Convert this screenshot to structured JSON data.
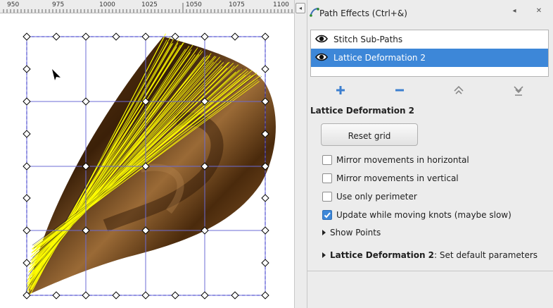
{
  "ruler": {
    "labels": [
      "950",
      "975",
      "1000",
      "1025",
      "1050",
      "1075",
      "1100"
    ]
  },
  "dialog": {
    "title": "Path Effects (Ctrl+&)",
    "iconify_glyph": "◂",
    "close_glyph": "✕",
    "collapse_glyph": "◂"
  },
  "effects": [
    {
      "name": "Stitch Sub-Paths",
      "visible": true,
      "selected": false
    },
    {
      "name": "Lattice Deformation 2",
      "visible": true,
      "selected": true
    }
  ],
  "toolbar": {
    "add_icon": "list-add-icon",
    "remove_icon": "list-remove-icon",
    "raise_icon": "go-up-icon",
    "lower_icon": "go-down-icon"
  },
  "settings": {
    "heading": "Lattice Deformation 2",
    "reset_label": "Reset grid",
    "options": [
      {
        "label": "Mirror movements in horizontal",
        "checked": false
      },
      {
        "label": "Mirror movements in vertical",
        "checked": false
      },
      {
        "label": "Use only perimeter",
        "checked": false
      },
      {
        "label": "Update while moving knots (maybe slow)",
        "checked": true
      }
    ],
    "show_points_label": "Show Points",
    "defaults_name": "Lattice Deformation 2",
    "defaults_suffix": ": Set default parameters"
  },
  "colors": {
    "selection": "#3d87d8",
    "grid": "#6b6bd6",
    "stitch": "#ffff00",
    "shape_dark": "#3a2008",
    "shape_light": "#8a5a2c"
  }
}
